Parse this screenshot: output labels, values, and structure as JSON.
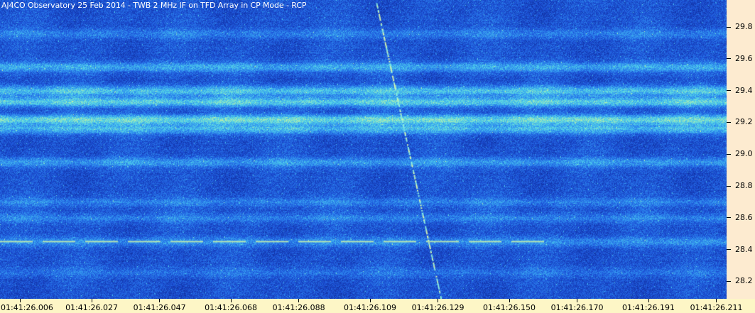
{
  "title": "AJ4CO Observatory 25 Feb 2014 - TWB 2 MHz IF on TFD Array in CP Mode - RCP",
  "chart_data": {
    "type": "heatmap",
    "title": "AJ4CO Observatory 25 Feb 2014 - TWB 2 MHz IF on TFD Array in CP Mode - RCP",
    "xlabel": "",
    "ylabel": "",
    "x_tick_labels": [
      "01:41:26.006",
      "01:41:26.027",
      "01:41:26.047",
      "01:41:26.068",
      "01:41:26.088",
      "01:41:26.109",
      "01:41:26.129",
      "01:41:26.150",
      "01:41:26.170",
      "01:41:26.191",
      "01:41:26.211"
    ],
    "y_tick_labels": [
      "29.8",
      "29.6",
      "29.4",
      "29.2",
      "29.0",
      "28.8",
      "28.6",
      "28.4",
      "28.2"
    ],
    "y_ticks": [
      29.8,
      29.6,
      29.4,
      29.2,
      29.0,
      28.8,
      28.6,
      28.4,
      28.2
    ],
    "ylim": [
      28.09,
      29.97
    ],
    "x_tick_times_s": [
      26.006,
      26.027,
      26.047,
      26.068,
      26.088,
      26.109,
      26.129,
      26.15,
      26.17,
      26.191,
      26.211
    ],
    "xlim_s": [
      26.0,
      26.214
    ],
    "colormap": [
      "#1030a0",
      "#1d52d8",
      "#2f8ef0",
      "#53d6e8",
      "#c8f0a0"
    ],
    "grid": false,
    "emission_bands_mhz": [
      {
        "center": 29.76,
        "intensity": 0.2
      },
      {
        "center": 29.55,
        "intensity": 0.35
      },
      {
        "center": 29.4,
        "intensity": 0.45
      },
      {
        "center": 29.33,
        "intensity": 0.5
      },
      {
        "center": 29.22,
        "intensity": 0.55
      },
      {
        "center": 29.16,
        "intensity": 0.4
      },
      {
        "center": 28.95,
        "intensity": 0.3
      },
      {
        "center": 28.7,
        "intensity": 0.2
      },
      {
        "center": 28.6,
        "intensity": 0.2
      },
      {
        "center": 28.45,
        "intensity": 0.25
      },
      {
        "center": 28.26,
        "intensity": 0.15
      }
    ],
    "carrier_line_mhz": 28.45,
    "drifting_burst": {
      "start_time_s": 26.111,
      "start_mhz": 29.95,
      "end_time_s": 26.13,
      "end_mhz": 28.09
    }
  }
}
